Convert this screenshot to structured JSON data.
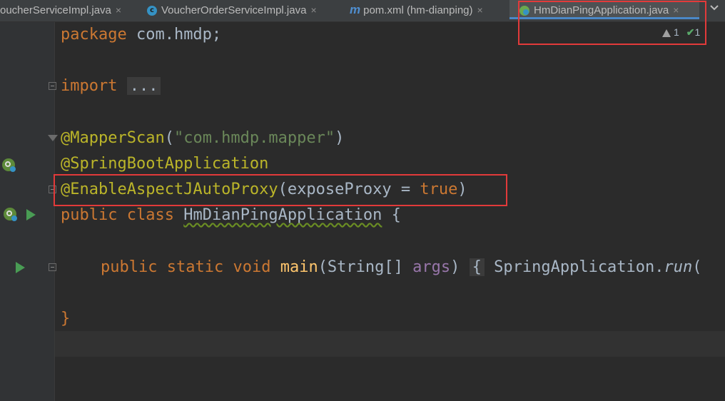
{
  "tabs": [
    {
      "label": "oucherServiceImpl.java",
      "icon": "none"
    },
    {
      "label": "VoucherOrderServiceImpl.java",
      "icon": "class-c-icon"
    },
    {
      "label": "pom.xml (hm-dianping)",
      "icon": "maven-m-icon"
    },
    {
      "label": "HmDianPingApplication.java",
      "icon": "spring-boot-icon",
      "active": true
    }
  ],
  "tab_close_glyph": "×",
  "tab_icon_letters": {
    "class": "c",
    "maven": "m"
  },
  "inspection": {
    "warnings": "1",
    "checks": "1"
  },
  "code": {
    "l1": {
      "kw": "package",
      "rest": " com.hmdp;"
    },
    "l3": {
      "kw": "import",
      "folded": "..."
    },
    "l5": {
      "ann": "@MapperScan",
      "open": "(",
      "str": "\"com.hmdp.mapper\"",
      "close": ")"
    },
    "l6": {
      "ann": "@SpringBootApplication"
    },
    "l7": {
      "ann": "@EnableAspectJAutoProxy",
      "open": "(",
      "param": "exposeProxy",
      "eq": " = ",
      "val": "true",
      "close": ")"
    },
    "l8": {
      "kw1": "public",
      "kw2": "class",
      "name": "HmDianPingApplication",
      "brace": " {"
    },
    "l10": {
      "kw1": "public",
      "kw2": "static",
      "kw3": "void",
      "fn": "main",
      "sig": "(String[] ",
      "param": "args",
      "sig_close": ")",
      "brace": "{",
      "call": " SpringApplication.",
      "call_fn": "run",
      "call_tail": "("
    },
    "l12": {
      "brace": "}"
    }
  },
  "colors": {
    "keyword": "#cc7832",
    "annotation": "#bbb529",
    "string": "#6a8759",
    "function": "#ffc66d",
    "param": "#9876aa",
    "text": "#a9b7c6",
    "highlight_box": "#e23a3a"
  }
}
